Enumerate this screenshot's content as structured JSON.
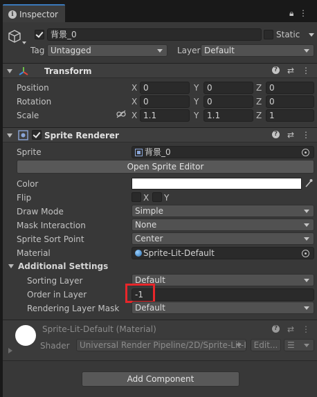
{
  "tab": {
    "title": "Inspector",
    "icon": "info-icon"
  },
  "gameobject": {
    "active": true,
    "name": "背景_0",
    "static_label": "Static",
    "static_checked": false,
    "tag_label": "Tag",
    "tag_value": "Untagged",
    "layer_label": "Layer",
    "layer_value": "Default"
  },
  "transform": {
    "title": "Transform",
    "position_label": "Position",
    "rotation_label": "Rotation",
    "scale_label": "Scale",
    "axis_x": "X",
    "axis_y": "Y",
    "axis_z": "Z",
    "position": {
      "x": "0",
      "y": "0",
      "z": "0"
    },
    "rotation": {
      "x": "0",
      "y": "0",
      "z": "0"
    },
    "scale": {
      "x": "1.1",
      "y": "1.1",
      "z": "1"
    }
  },
  "sprite_renderer": {
    "title": "Sprite Renderer",
    "enabled": true,
    "sprite_label": "Sprite",
    "sprite_value": "背景_0",
    "open_editor_label": "Open Sprite Editor",
    "color_label": "Color",
    "color_value": "#ffffff",
    "flip_label": "Flip",
    "flip_x": "X",
    "flip_y": "Y",
    "draw_mode_label": "Draw Mode",
    "draw_mode_value": "Simple",
    "mask_label": "Mask Interaction",
    "mask_value": "None",
    "sort_point_label": "Sprite Sort Point",
    "sort_point_value": "Center",
    "material_label": "Material",
    "material_value": "Sprite-Lit-Default",
    "additional_label": "Additional Settings",
    "sorting_layer_label": "Sorting Layer",
    "sorting_layer_value": "Default",
    "order_label": "Order in Layer",
    "order_value": "-1",
    "rendering_mask_label": "Rendering Layer Mask",
    "rendering_mask_value": "Default"
  },
  "material": {
    "title": "Sprite-Lit-Default (Material)",
    "shader_label": "Shader",
    "shader_value": "Universal Render Pipeline/2D/Sprite-Lit-I",
    "edit_label": "Edit..."
  },
  "add_component_label": "Add Component",
  "colors": {
    "highlight": "#e8262a",
    "accent_tab": "#3a79bb"
  }
}
